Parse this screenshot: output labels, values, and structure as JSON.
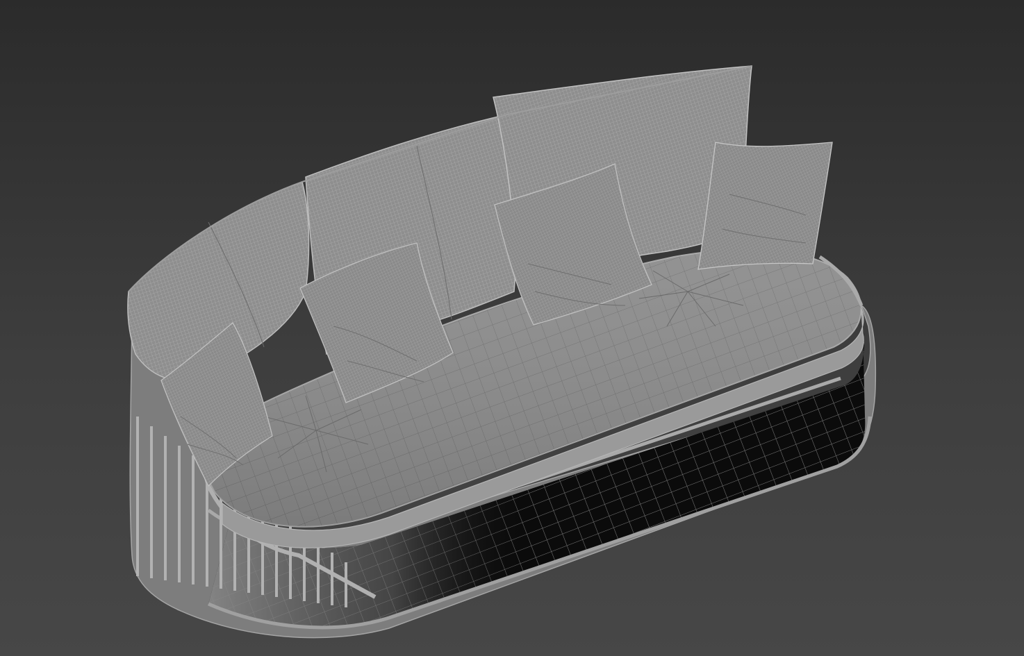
{
  "viewport": {
    "render_mode": "wireframe-shaded",
    "background_top": "#2b2b2b",
    "background_bottom": "#474747",
    "mesh_color": "#8a8a8a",
    "wire_color": "#b4b4b4",
    "shadow_color": "#050505"
  },
  "model": {
    "object": "rounded-daybed-sofa",
    "parts": [
      "sofa-frame",
      "seat-cushion",
      "back-cushions",
      "throw-pillows",
      "rail-slats"
    ]
  }
}
